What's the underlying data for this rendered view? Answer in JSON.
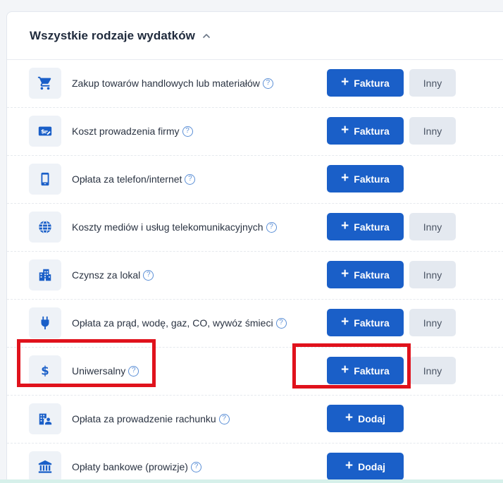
{
  "section": {
    "title": "Wszystkie rodzaje wydatków",
    "collapse_icon": "chevron-up-icon"
  },
  "rows": [
    {
      "label": "Zakup towarów handlowych lub materiałów",
      "icon": "cart-icon",
      "primary": "Faktura",
      "secondary": "Inny"
    },
    {
      "label": "Koszt prowadzenia firmy",
      "icon": "money-card-icon",
      "primary": "Faktura",
      "secondary": "Inny"
    },
    {
      "label": "Opłata za telefon/internet",
      "icon": "phone-icon",
      "primary": "Faktura",
      "secondary": null
    },
    {
      "label": "Koszty mediów i usług telekomunikacyjnych",
      "icon": "globe-icon",
      "primary": "Faktura",
      "secondary": "Inny"
    },
    {
      "label": "Czynsz za lokal",
      "icon": "building-icon",
      "primary": "Faktura",
      "secondary": "Inny"
    },
    {
      "label": "Opłata za prąd, wodę, gaz, CO, wywóz śmieci",
      "icon": "plug-icon",
      "primary": "Faktura",
      "secondary": "Inny"
    },
    {
      "label": "Uniwersalny",
      "icon": "dollar-icon",
      "primary": "Faktura",
      "secondary": "Inny"
    },
    {
      "label": "Opłata za prowadzenie rachunku",
      "icon": "bank-account-icon",
      "primary": "Dodaj",
      "secondary": null
    },
    {
      "label": "Opłaty bankowe (prowizje)",
      "icon": "bank-icon",
      "primary": "Dodaj",
      "secondary": null
    }
  ],
  "help_icon": "question-circle-icon",
  "colors": {
    "primary": "#1a5fc8",
    "secondary_bg": "#e4e9f0",
    "icon": "#1a5fc8",
    "highlight": "#e0121c"
  }
}
